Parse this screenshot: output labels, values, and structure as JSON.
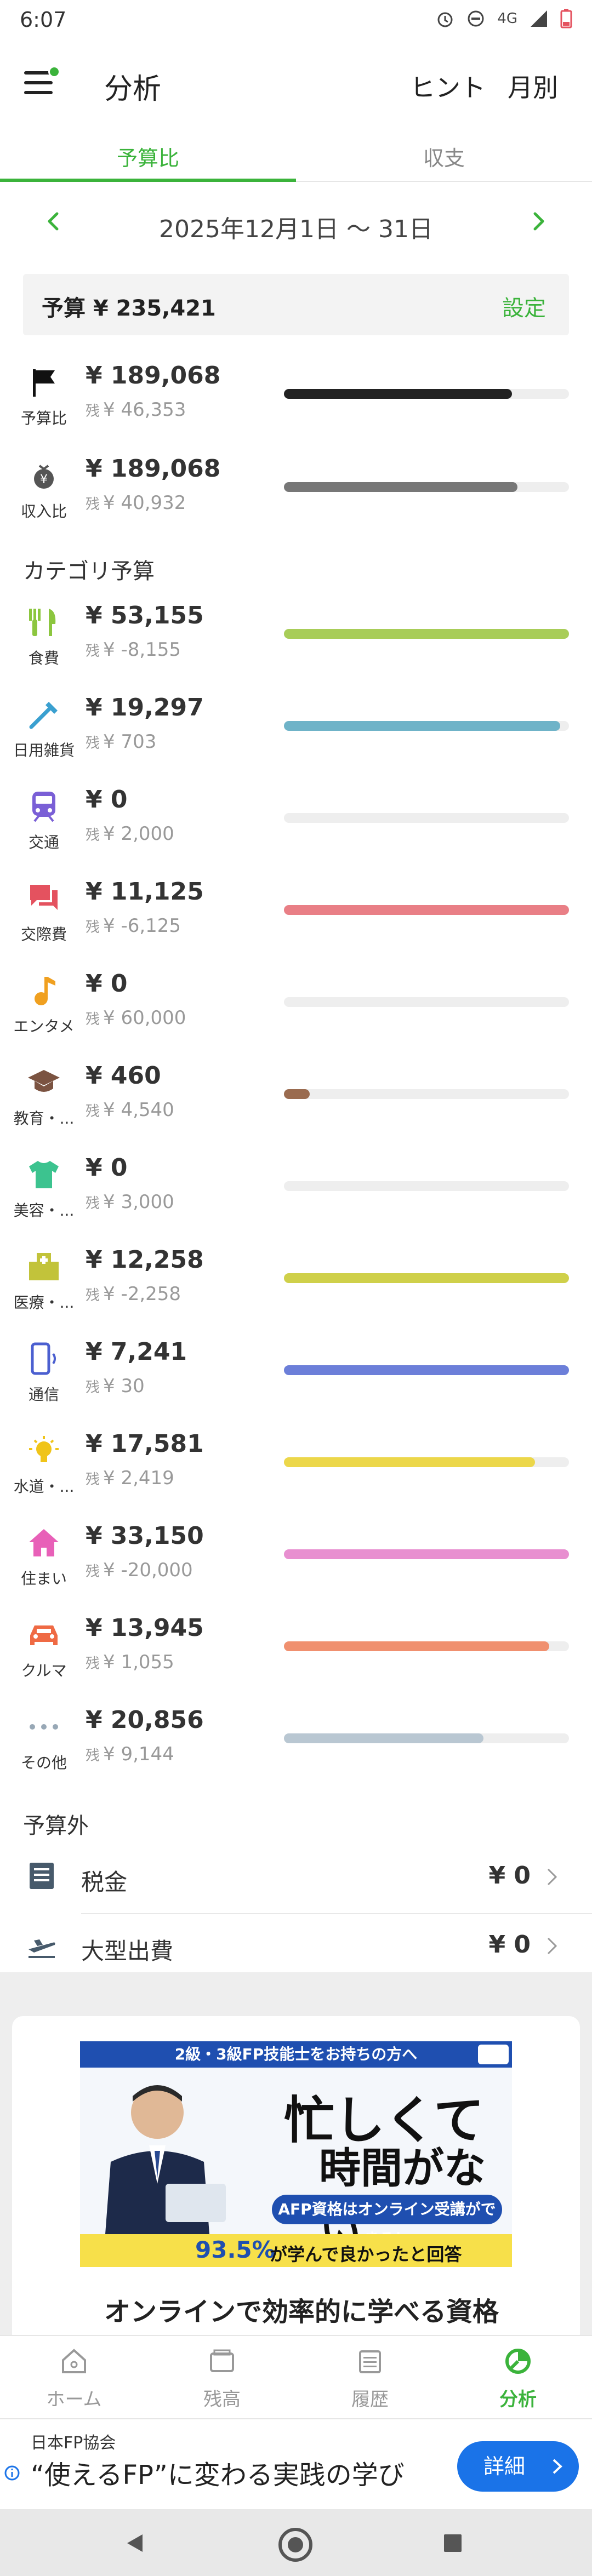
{
  "status_bar": {
    "time": "6:07",
    "network": "4G"
  },
  "header": {
    "title": "分析",
    "hint": "ヒント",
    "monthly": "月別"
  },
  "tabs": [
    {
      "label": "予算比"
    },
    {
      "label": "収支"
    }
  ],
  "period": {
    "range": "2025年12月1日 〜 31日"
  },
  "budget": {
    "label": "予算 ¥ 235,421",
    "settings": "設定"
  },
  "summary": [
    {
      "icon": "flag-icon",
      "label": "予算比",
      "amount": "¥ 189,068",
      "remaining": "¥ 46,353",
      "progress": 0.8,
      "color": "#222222"
    },
    {
      "icon": "money-bag-icon",
      "label": "収入比",
      "amount": "¥ 189,068",
      "remaining": "¥ 40,932",
      "progress": 0.82,
      "color": "#777777"
    }
  ],
  "remaining_prefix": "残",
  "category_section": "カテゴリ予算",
  "categories": [
    {
      "icon": "fork-knife-icon",
      "label": "食費",
      "amount": "¥ 53,155",
      "remaining": "¥ -8,155",
      "progress": 1.0,
      "color": "#a8cd58",
      "icon_color": "#8cc63f"
    },
    {
      "icon": "toothbrush-icon",
      "label": "日用雑貨",
      "amount": "¥ 19,297",
      "remaining": "¥ 703",
      "progress": 0.97,
      "color": "#6fb3c8",
      "icon_color": "#3aa0d0"
    },
    {
      "icon": "train-icon",
      "label": "交通",
      "amount": "¥ 0",
      "remaining": "¥ 2,000",
      "progress": 0,
      "color": "#7a5fd6",
      "icon_color": "#7a5fd6"
    },
    {
      "icon": "chat-icon",
      "label": "交際費",
      "amount": "¥ 11,125",
      "remaining": "¥ -6,125",
      "progress": 1.0,
      "color": "#e97f86",
      "icon_color": "#e4525f"
    },
    {
      "icon": "music-note-icon",
      "label": "エンタメ",
      "amount": "¥ 0",
      "remaining": "¥ 60,000",
      "progress": 0,
      "color": "#f0a020",
      "icon_color": "#f0a020"
    },
    {
      "icon": "graduation-cap-icon",
      "label": "教育・...",
      "amount": "¥ 460",
      "remaining": "¥ 4,540",
      "progress": 0.09,
      "color": "#9a6b4f",
      "icon_color": "#7b5341"
    },
    {
      "icon": "shirt-icon",
      "label": "美容・...",
      "amount": "¥ 0",
      "remaining": "¥ 3,000",
      "progress": 0,
      "color": "#3cc38f",
      "icon_color": "#3cc38f"
    },
    {
      "icon": "hospital-icon",
      "label": "医療・...",
      "amount": "¥ 12,258",
      "remaining": "¥ -2,258",
      "progress": 1.0,
      "color": "#cfd04a",
      "icon_color": "#c2c33a"
    },
    {
      "icon": "phone-icon",
      "label": "通信",
      "amount": "¥ 7,241",
      "remaining": "¥ 30",
      "progress": 1.0,
      "color": "#6c7fd9",
      "icon_color": "#4b5fd0"
    },
    {
      "icon": "lightbulb-icon",
      "label": "水道・...",
      "amount": "¥ 17,581",
      "remaining": "¥ 2,419",
      "progress": 0.88,
      "color": "#ecd74a",
      "icon_color": "#f0c419"
    },
    {
      "icon": "house-icon",
      "label": "住まい",
      "amount": "¥ 33,150",
      "remaining": "¥ -20,000",
      "progress": 1.0,
      "color": "#e88fd0",
      "icon_color": "#e860b8"
    },
    {
      "icon": "car-icon",
      "label": "クルマ",
      "amount": "¥ 13,945",
      "remaining": "¥ 1,055",
      "progress": 0.93,
      "color": "#f0906f",
      "icon_color": "#ef6a44"
    },
    {
      "icon": "more-dots-icon",
      "label": "その他",
      "amount": "¥ 20,856",
      "remaining": "¥ 9,144",
      "progress": 0.7,
      "color": "#b9c7d2",
      "icon_color": "#98a8b6"
    }
  ],
  "outside_section": "予算外",
  "outside": [
    {
      "icon": "receipt-icon",
      "label": "税金",
      "value": "¥ 0"
    },
    {
      "icon": "airplane-icon",
      "label": "大型出費",
      "value": "¥ 0"
    }
  ],
  "ad": {
    "top_text": "2級・3級FP技能士をお持ちの方へ",
    "big1": "忙しくて",
    "big2": "時間がない…",
    "pill": "AFP資格はオンライン受講ができる！",
    "pct": "93.5%",
    "pct_text": "が学んで良かったと回答",
    "headline": "オンラインで効率的に学べる資格"
  },
  "bottom_nav": [
    {
      "icon": "home-icon",
      "label": "ホーム"
    },
    {
      "icon": "wallet-icon",
      "label": "残高"
    },
    {
      "icon": "history-icon",
      "label": "履歴"
    },
    {
      "icon": "analysis-icon",
      "label": "分析"
    }
  ],
  "banner": {
    "org": "日本FP協会",
    "copy": "“使えるFP”に変わる実践の学び",
    "button": "詳細"
  },
  "colors": {
    "accent": "#3bb33b",
    "track": "#eeeeee"
  }
}
